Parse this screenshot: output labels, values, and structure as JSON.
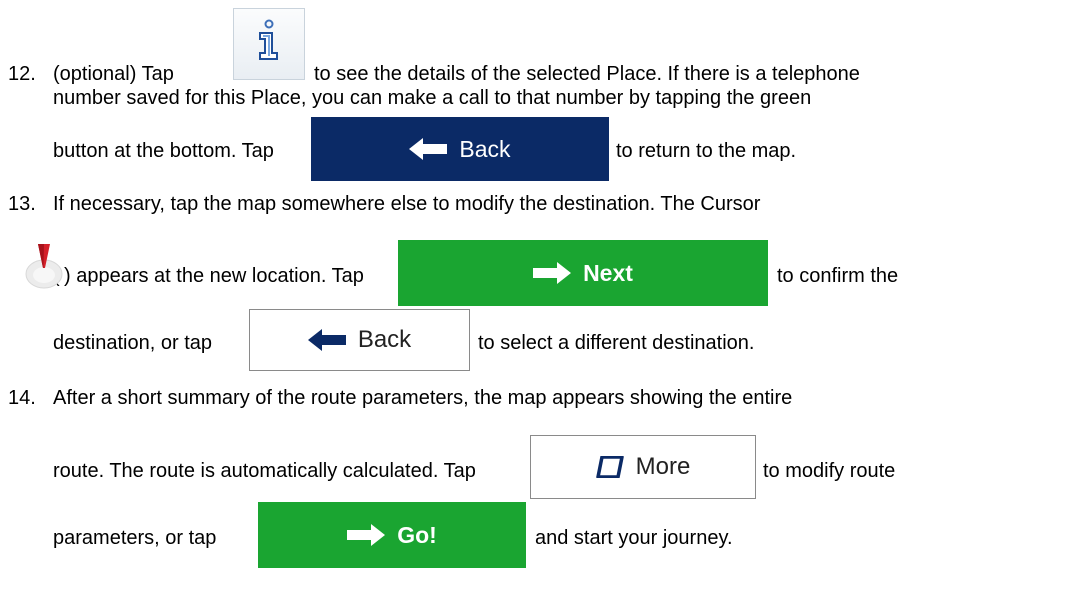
{
  "step12": {
    "num": "12.",
    "a": "(optional) Tap",
    "b": "to see the details of the selected Place.  If there is a telephone",
    "line2": "number saved for this Place, you can make a call to that number by tapping the green",
    "line3a": "button at the bottom. Tap",
    "line3b": "to return to the map."
  },
  "step13": {
    "num": "13.",
    "line1": "If necessary, tap the map somewhere else to modify the destination. The Cursor",
    "line2a": "(",
    "line2b": ") appears at the new location. Tap",
    "line2c": "to confirm the",
    "line3a": "destination, or tap",
    "line3b": "to select a different destination."
  },
  "step14": {
    "num": "14.",
    "line1": "After a short summary of the route parameters, the map appears showing the entire",
    "line2a": "route. The route is automatically calculated. Tap",
    "line2b": "to modify route",
    "line3a": "parameters, or tap",
    "line3b": "and start your journey."
  },
  "buttons": {
    "back_dark": "Back",
    "next": "Next",
    "back_light": "Back",
    "more": "More",
    "go": "Go!"
  },
  "icons": {
    "info": "info-icon",
    "cursor": "map-cursor-icon",
    "arrow_left": "arrow-left-icon",
    "arrow_right": "arrow-right-icon",
    "more": "rounded-square-icon"
  },
  "colors": {
    "back_dark_bg": "#0b2a66",
    "green_bg": "#1aa531",
    "cursor_red": "#d4202a"
  }
}
